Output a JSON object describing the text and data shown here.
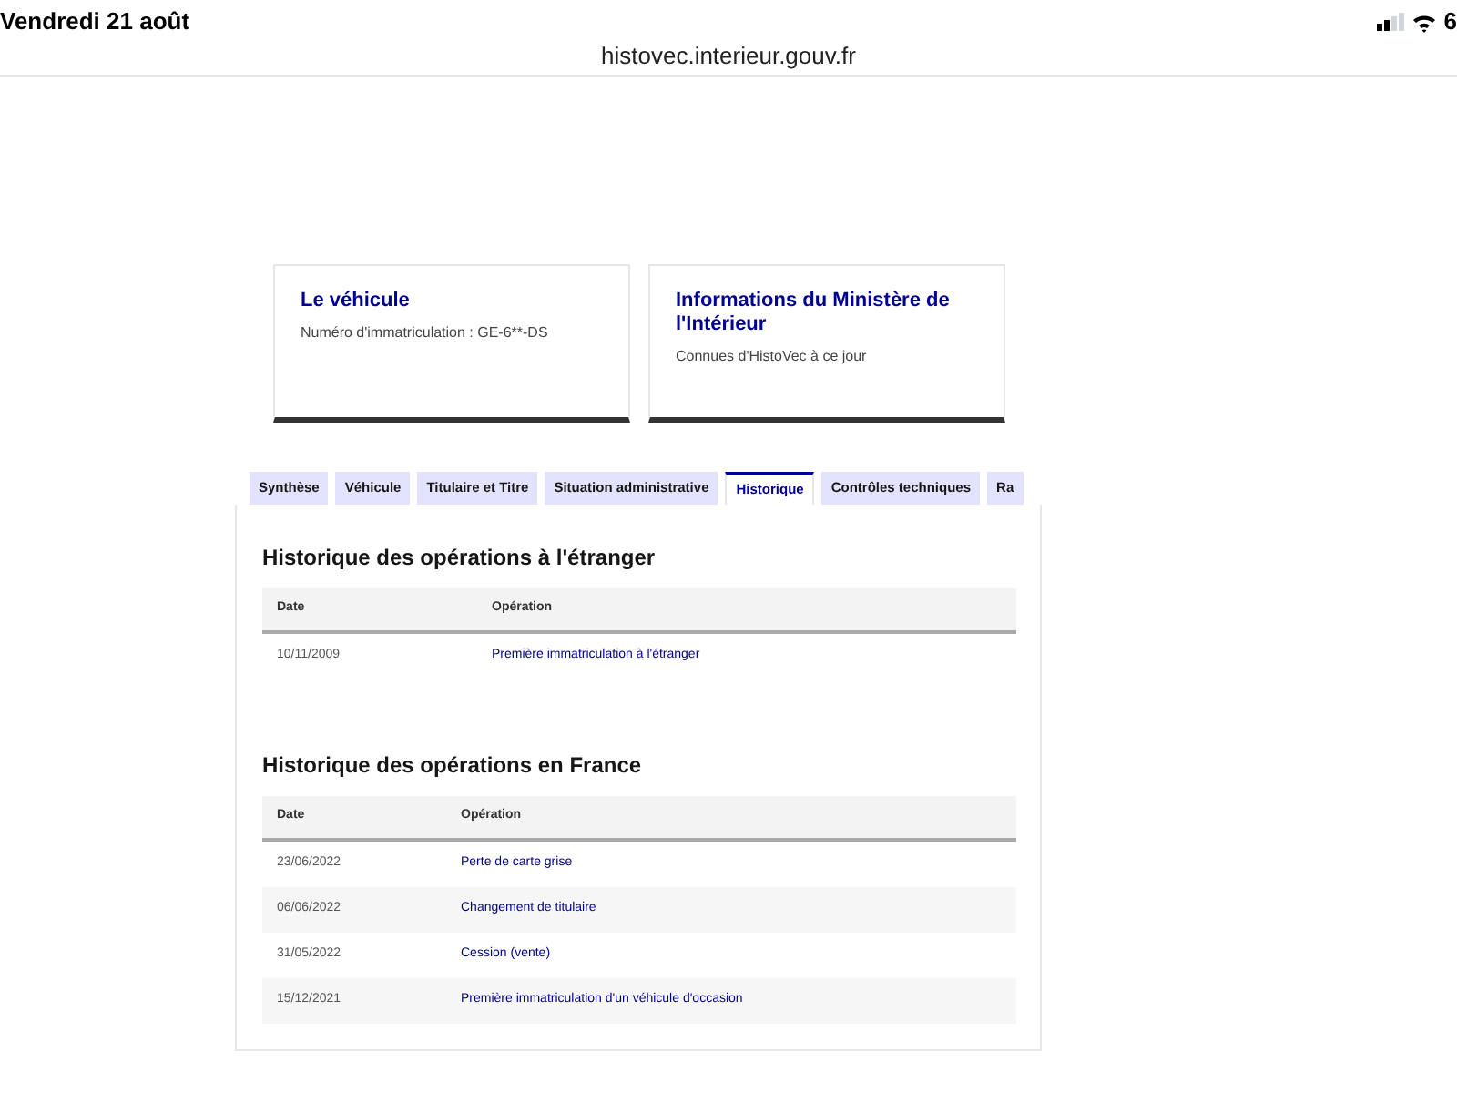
{
  "status_bar": {
    "date": "Vendredi 21 août",
    "battery": "6"
  },
  "browser": {
    "url": "histovec.interieur.gouv.fr"
  },
  "cards": [
    {
      "title": "Le véhicule",
      "text": "Numéro d'immatriculation : GE-6**-DS"
    },
    {
      "title": "Informations du Ministère de l'Intérieur",
      "text": "Connues d'HistoVec à ce jour"
    }
  ],
  "tabs": [
    {
      "label": "Synthèse",
      "selected": false
    },
    {
      "label": "Véhicule",
      "selected": false
    },
    {
      "label": "Titulaire et Titre",
      "selected": false
    },
    {
      "label": "Situation administrative",
      "selected": false
    },
    {
      "label": "Historique",
      "selected": true
    },
    {
      "label": "Contrôles techniques",
      "selected": false
    },
    {
      "label": "Ra",
      "selected": false
    }
  ],
  "sections": [
    {
      "title": "Historique des opérations à l'étranger",
      "columns": [
        "Date",
        "Opération"
      ],
      "rows": [
        [
          "10/11/2009",
          "Première immatriculation à l'étranger"
        ]
      ]
    },
    {
      "title": "Historique des opérations en France",
      "columns": [
        "Date",
        "Opération"
      ],
      "rows": [
        [
          "23/06/2022",
          "Perte de carte grise"
        ],
        [
          "06/06/2022",
          "Changement de titulaire"
        ],
        [
          "31/05/2022",
          "Cession (vente)"
        ],
        [
          "15/12/2021",
          "Première immatriculation d'un véhicule d'occasion"
        ]
      ]
    }
  ]
}
